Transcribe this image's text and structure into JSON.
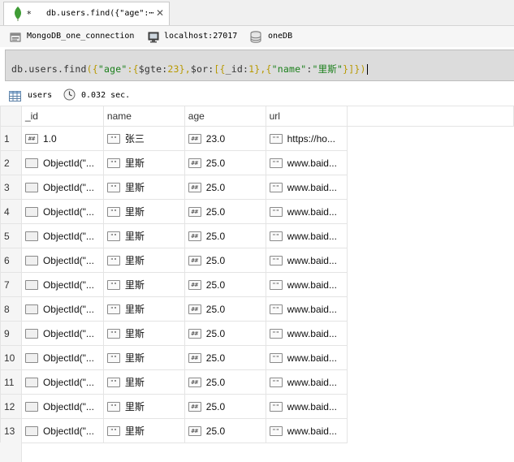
{
  "tab": {
    "modified_marker": "*",
    "title": "db.users.find({\"age\":⋯",
    "close": "✕"
  },
  "connection": {
    "name": "MongoDB_one_connection",
    "host": "localhost:27017",
    "database": "oneDB"
  },
  "query": {
    "p1": "db.users.find",
    "p2": "({",
    "p3": "\"age\"",
    "p4": ":{",
    "p5": "$gte:",
    "p6": "23",
    "p7": "},",
    "p8": "$or:",
    "p9": "[{",
    "p10": "_id:",
    "p11": "1",
    "p12": "},{",
    "p13": "\"name\"",
    "p14": ":",
    "p15": "\"里斯\"",
    "p16": "}]})"
  },
  "status": {
    "collection": "users",
    "time": "0.032 sec."
  },
  "table": {
    "columns": [
      "_id",
      "name",
      "age",
      "url"
    ],
    "type_tags": {
      "number": "##",
      "string": "\"\"",
      "object": ""
    },
    "rows": [
      {
        "n": "1",
        "id": "1.0",
        "id_type": "number",
        "name": "张三",
        "age": "23.0",
        "url": "https://ho..."
      },
      {
        "n": "2",
        "id": "ObjectId(\"...",
        "id_type": "object",
        "name": "里斯",
        "age": "25.0",
        "url": "www.baid..."
      },
      {
        "n": "3",
        "id": "ObjectId(\"...",
        "id_type": "object",
        "name": "里斯",
        "age": "25.0",
        "url": "www.baid..."
      },
      {
        "n": "4",
        "id": "ObjectId(\"...",
        "id_type": "object",
        "name": "里斯",
        "age": "25.0",
        "url": "www.baid..."
      },
      {
        "n": "5",
        "id": "ObjectId(\"...",
        "id_type": "object",
        "name": "里斯",
        "age": "25.0",
        "url": "www.baid..."
      },
      {
        "n": "6",
        "id": "ObjectId(\"...",
        "id_type": "object",
        "name": "里斯",
        "age": "25.0",
        "url": "www.baid..."
      },
      {
        "n": "7",
        "id": "ObjectId(\"...",
        "id_type": "object",
        "name": "里斯",
        "age": "25.0",
        "url": "www.baid..."
      },
      {
        "n": "8",
        "id": "ObjectId(\"...",
        "id_type": "object",
        "name": "里斯",
        "age": "25.0",
        "url": "www.baid..."
      },
      {
        "n": "9",
        "id": "ObjectId(\"...",
        "id_type": "object",
        "name": "里斯",
        "age": "25.0",
        "url": "www.baid..."
      },
      {
        "n": "10",
        "id": "ObjectId(\"...",
        "id_type": "object",
        "name": "里斯",
        "age": "25.0",
        "url": "www.baid..."
      },
      {
        "n": "11",
        "id": "ObjectId(\"...",
        "id_type": "object",
        "name": "里斯",
        "age": "25.0",
        "url": "www.baid..."
      },
      {
        "n": "12",
        "id": "ObjectId(\"...",
        "id_type": "object",
        "name": "里斯",
        "age": "25.0",
        "url": "www.baid..."
      },
      {
        "n": "13",
        "id": "ObjectId(\"...",
        "id_type": "object",
        "name": "里斯",
        "age": "25.0",
        "url": "www.baid..."
      }
    ]
  },
  "icons": {
    "tab": "mongodb-leaf-icon",
    "connection": "server-connection-icon",
    "host": "monitor-icon",
    "database": "database-icon",
    "collection": "table-grid-icon",
    "time": "clock-icon"
  }
}
